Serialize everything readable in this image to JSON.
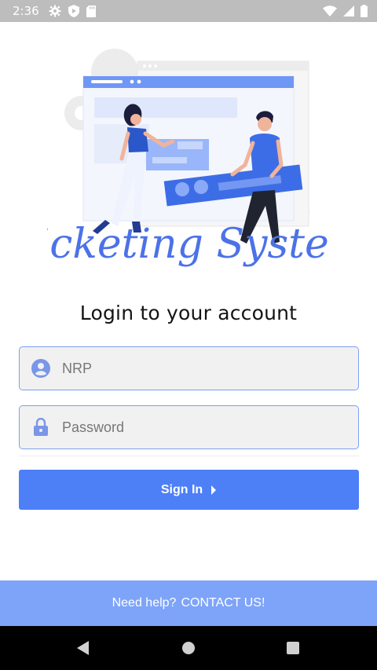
{
  "status_bar": {
    "time": "2:36",
    "icons": [
      "gear-icon",
      "shield-icon",
      "sd-card-icon",
      "wifi-icon",
      "signal-icon",
      "battery-icon"
    ]
  },
  "hero": {
    "logo_text": "Ticketing System"
  },
  "login": {
    "title": "Login to your account",
    "nrp_placeholder": "NRP",
    "password_placeholder": "Password",
    "signin_label": "Sign In"
  },
  "help": {
    "text": "Need help?",
    "contact_label": "CONTACT US!"
  },
  "colors": {
    "accent": "#4d7ff7",
    "help_bar": "#7ea4f9",
    "field_border": "#7aa0f3",
    "status_bar": "#bdbdbd"
  }
}
